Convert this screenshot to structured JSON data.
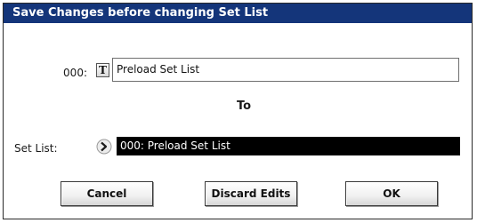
{
  "dialog": {
    "title": "Save Changes before changing Set List"
  },
  "source": {
    "number": "000:",
    "text_edit_icon_glyph": "T",
    "name": "Preload Set List"
  },
  "to_label": "To",
  "set_list": {
    "label": "Set List:",
    "selected": "000: Preload Set List",
    "icon": "popup-arrow-icon"
  },
  "buttons": {
    "cancel": "Cancel",
    "discard": "Discard Edits",
    "ok": "OK"
  },
  "colors": {
    "title_bar": "#14357a",
    "selected_field": "#000000"
  }
}
